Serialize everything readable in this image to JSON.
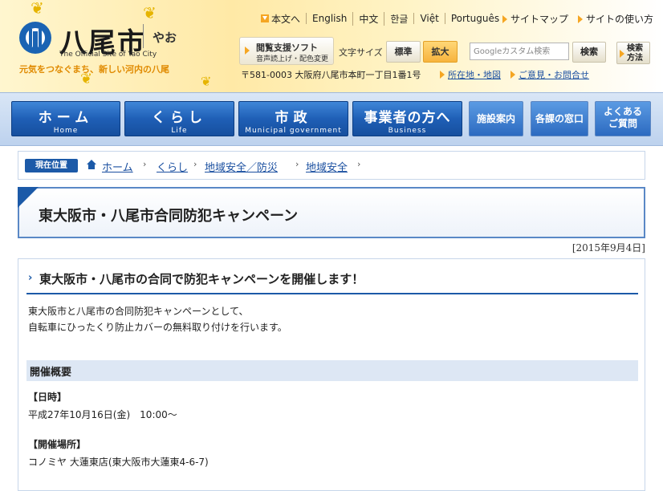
{
  "header": {
    "logo_title": "八尾市",
    "logo_kana": "やお",
    "logo_en": "The Official Site of Yao City",
    "tagline": "元気をつなぐまち、新しい河内の八尾",
    "languages": [
      "本文へ",
      "English",
      "中文",
      "한글",
      "Việt",
      "Português"
    ],
    "top_links": [
      "サイトマップ",
      "サイトの使い方"
    ],
    "reader_tool_line1": "閲覧支援ソフト",
    "reader_tool_line2": "音声読上げ・配色変更",
    "font_size_label": "文字サイズ",
    "font_standard": "標準",
    "font_large": "拡大",
    "search_placeholder": "Googleカスタム検索",
    "search_button": "検索",
    "search_help": "検索方法",
    "address": "〒581-0003 大阪府八尾市本町一丁目1番1号",
    "address_links": [
      "所在地・地図",
      "ご意見・お問合せ"
    ]
  },
  "nav": {
    "main": [
      {
        "jp": "ホーム",
        "en": "Home"
      },
      {
        "jp": "くらし",
        "en": "Life"
      },
      {
        "jp": "市政",
        "en": "Municipal government"
      },
      {
        "jp": "事業者の方へ",
        "en": "Business"
      }
    ],
    "sub": [
      "施設案内",
      "各課の窓口",
      "よくある\nご質問"
    ]
  },
  "breadcrumb": {
    "badge": "現在位置",
    "items": [
      "ホーム",
      "くらし",
      "地域安全／防災",
      "地域安全"
    ]
  },
  "page": {
    "title": "東大阪市・八尾市合同防犯キャンペーン",
    "date": "[2015年9月4日]"
  },
  "content": {
    "heading": "東大阪市・八尾市の合同で防犯キャンペーンを開催します！",
    "intro_line1": "東大阪市と八尾市の合同防犯キャンペーンとして、",
    "intro_line2": "自転車にひったくり防止カバーの無料取り付けを行います。",
    "section_title": "開催概要",
    "datetime_label": "【日時】",
    "datetime_value": "平成27年10月16日(金)　10:00〜",
    "venue_label": "【開催場所】",
    "venue_value": "コノミヤ 大蓮東店(東大阪市大蓮東4-6-7)"
  },
  "colors": {
    "brand_blue": "#1c5aa8",
    "accent_orange": "#f5a623",
    "header_yellow": "#ffe9a6"
  }
}
